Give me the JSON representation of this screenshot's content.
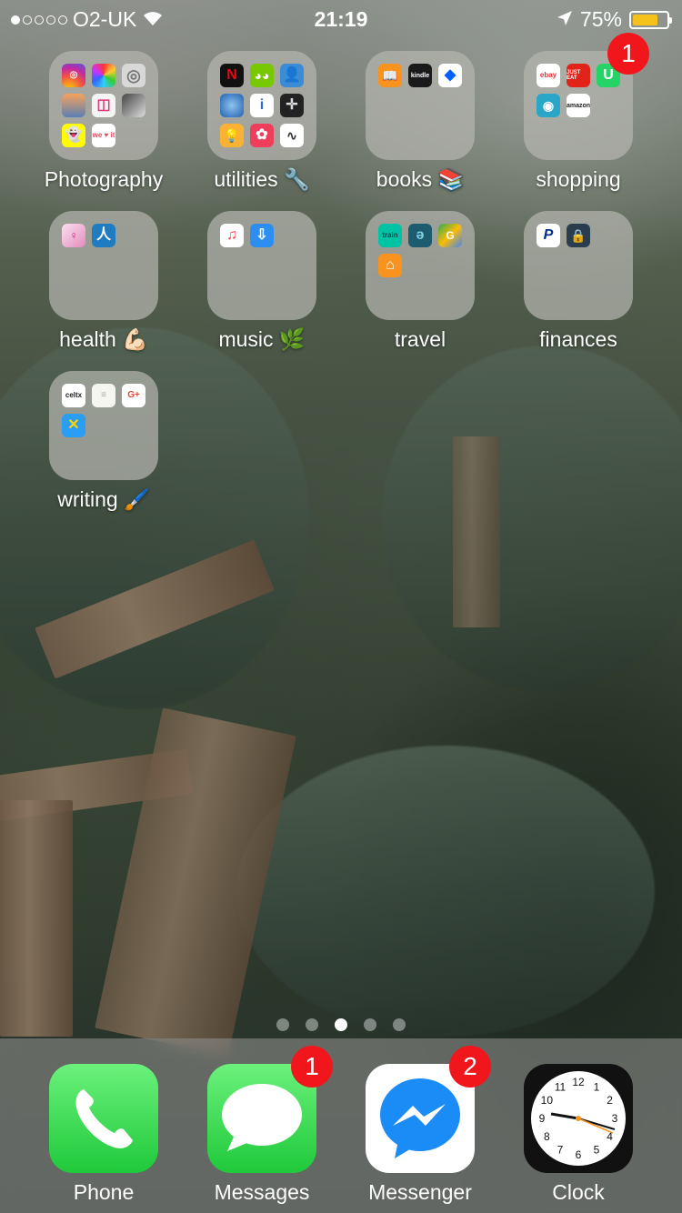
{
  "status": {
    "carrier": "O2-UK",
    "time": "21:19",
    "battery": "75%",
    "battery_fraction": 0.75,
    "signal_bars": 1,
    "signal_total": 5
  },
  "folders": [
    {
      "label": "Photography",
      "icons": [
        "instagram-icon",
        "color-wheel-icon",
        "camera-aperture-icon",
        "photo-editor-icon",
        "layout-icon",
        "portrait-icon",
        "snapchat-icon",
        "weheartit-icon"
      ]
    },
    {
      "label": "utilities 🔧",
      "icons": [
        "netflix-icon",
        "duolingo-icon",
        "contacts-icon",
        "globe-icon",
        "info-icon",
        "compass-icon",
        "lightbulb-icon",
        "flower-icon",
        "voice-memos-icon"
      ]
    },
    {
      "label": "books 📚",
      "icons": [
        "ibooks-icon",
        "kindle-icon",
        "dropbox-icon"
      ]
    },
    {
      "label": "shopping",
      "icons": [
        "ebay-icon",
        "just-eat-icon",
        "u-icon",
        "fish-icon",
        "amazon-icon"
      ],
      "badge": "1"
    },
    {
      "label": "health 💪🏻",
      "icons": [
        "fitness-icon",
        "stretch-icon"
      ]
    },
    {
      "label": "music 🌿",
      "icons": [
        "itunes-icon",
        "download-icon"
      ]
    },
    {
      "label": "travel",
      "icons": [
        "trainline-icon",
        "ear-icon",
        "maps-icon",
        "home-icon"
      ]
    },
    {
      "label": "finances",
      "icons": [
        "paypal-icon",
        "lock-icon"
      ]
    },
    {
      "label": "writing 🖌️",
      "icons": [
        "celtx-icon",
        "notes-icon",
        "google-plus-icon",
        "x-app-icon"
      ]
    }
  ],
  "mini_text": {
    "instagram": "",
    "netflix": "N",
    "kindle": "kindle",
    "ebay": "ebay",
    "just_eat": "JUST EAT",
    "u": "U",
    "amazon": "amazon",
    "trainline": "train",
    "paypal": "P",
    "celtx": "celtx",
    "google_plus": "G+",
    "weheartit": "we ♥ it"
  },
  "page_dots": {
    "count": 5,
    "active": 2
  },
  "dock": [
    {
      "label": "Phone",
      "icon": "phone-icon"
    },
    {
      "label": "Messages",
      "icon": "messages-icon",
      "badge": "1"
    },
    {
      "label": "Messenger",
      "icon": "messenger-icon",
      "badge": "2"
    },
    {
      "label": "Clock",
      "icon": "clock-icon"
    }
  ],
  "clock_numbers": [
    "12",
    "1",
    "2",
    "3",
    "4",
    "5",
    "6",
    "7",
    "8",
    "9",
    "10",
    "11"
  ]
}
